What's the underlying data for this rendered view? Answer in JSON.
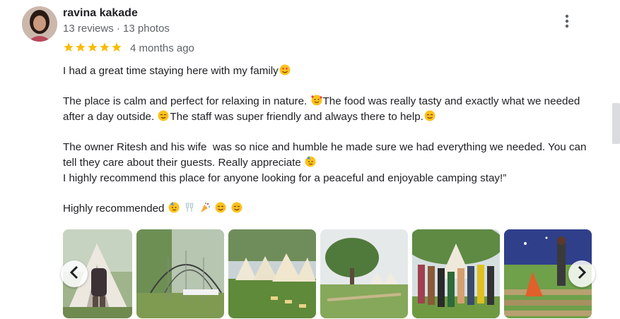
{
  "review": {
    "author": "ravina kakade",
    "meta": "13 reviews · 13 photos",
    "rating": 5,
    "date": "4 months ago",
    "avatar_icon": "user-avatar-photo",
    "menu_icon": "more-vert-icon",
    "paragraphs": [
      {
        "id": "p1",
        "segments": [
          "I had a great time staying here with my family",
          {
            "emoji": "heart-eyes"
          }
        ]
      },
      {
        "id": "p2",
        "segments": [
          "The place is calm and perfect for relaxing in nature. ",
          {
            "emoji": "smiling-hearts"
          },
          "The food was really tasty and exactly what we needed after a day outside. ",
          {
            "emoji": "yum"
          },
          "The staff was super friendly and always there to help.",
          {
            "emoji": "smile"
          }
        ]
      },
      {
        "id": "p3",
        "segments": [
          "The owner Ritesh and his wife  was so nice and humble he made sure we had everything we needed. You can tell they care about their guests. Really appreciate ",
          {
            "emoji": "party-face"
          },
          "\nI highly recommend this place for anyone looking for a peaceful and enjoyable camping stay!”"
        ]
      },
      {
        "id": "p4",
        "segments": [
          "Highly recommended ",
          {
            "emoji": "party-face"
          },
          " ",
          {
            "emoji": "clinking-glasses"
          },
          " ",
          {
            "emoji": "party-popper"
          },
          " ",
          {
            "emoji": "smile"
          },
          " ",
          {
            "emoji": "smile"
          }
        ]
      }
    ],
    "photos": [
      {
        "name": "photo-tent-person"
      },
      {
        "name": "photo-dome-structure"
      },
      {
        "name": "photo-tents-row"
      },
      {
        "name": "photo-trees-tents"
      },
      {
        "name": "photo-group"
      },
      {
        "name": "photo-steps-people"
      }
    ],
    "nav": {
      "prev_icon": "chevron-left-icon",
      "next_icon": "chevron-right-icon"
    }
  },
  "colors": {
    "star": "#fbbc04",
    "secondary_text": "#5f6368",
    "primary_text": "#202124"
  }
}
